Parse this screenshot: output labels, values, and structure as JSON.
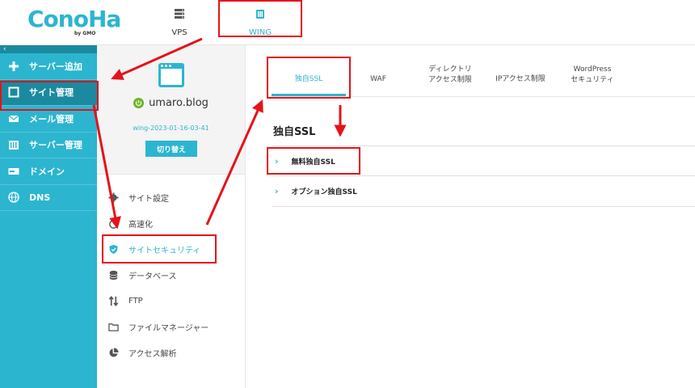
{
  "header": {
    "logo": "ConoHa",
    "logo_sub": "by GMO",
    "tabs": [
      {
        "label": "VPS",
        "icon": "server-icon"
      },
      {
        "label": "WING",
        "icon": "wing-icon"
      }
    ]
  },
  "sidebar": {
    "collapse": "‹",
    "items": [
      {
        "label": "サーバー追加",
        "icon": "plus-icon"
      },
      {
        "label": "サイト管理",
        "icon": "site-icon"
      },
      {
        "label": "メール管理",
        "icon": "mail-icon"
      },
      {
        "label": "サーバー管理",
        "icon": "server-manage-icon"
      },
      {
        "label": "ドメイン",
        "icon": "domain-icon"
      },
      {
        "label": "DNS",
        "icon": "globe-icon"
      }
    ]
  },
  "site": {
    "name": "umaro.blog",
    "id": "wing-2023-01-16-03-41",
    "switch_label": "切り替え"
  },
  "site_menu": [
    {
      "label": "サイト設定",
      "icon": "gear-icon"
    },
    {
      "label": "高速化",
      "icon": "speed-icon"
    },
    {
      "label": "サイトセキュリティ",
      "icon": "shield-icon"
    },
    {
      "label": "データベース",
      "icon": "database-icon"
    },
    {
      "label": "FTP",
      "icon": "ftp-icon"
    },
    {
      "label": "ファイルマネージャー",
      "icon": "folder-icon"
    },
    {
      "label": "アクセス解析",
      "icon": "pie-chart-icon"
    }
  ],
  "main": {
    "tabs": [
      {
        "line1": "独自SSL",
        "line2": ""
      },
      {
        "line1": "WAF",
        "line2": ""
      },
      {
        "line1": "ディレクトリ",
        "line2": "アクセス制限"
      },
      {
        "line1": "IPアクセス制限",
        "line2": ""
      },
      {
        "line1": "WordPress",
        "line2": "セキュリティ"
      }
    ],
    "section_title": "独自SSL",
    "accordions": [
      {
        "label": "無料独自SSL"
      },
      {
        "label": "オプション独自SSL"
      }
    ]
  },
  "colors": {
    "accent": "#2cb5cf",
    "accent_dark": "#1b8aa0",
    "annotation": "#e5121b"
  }
}
